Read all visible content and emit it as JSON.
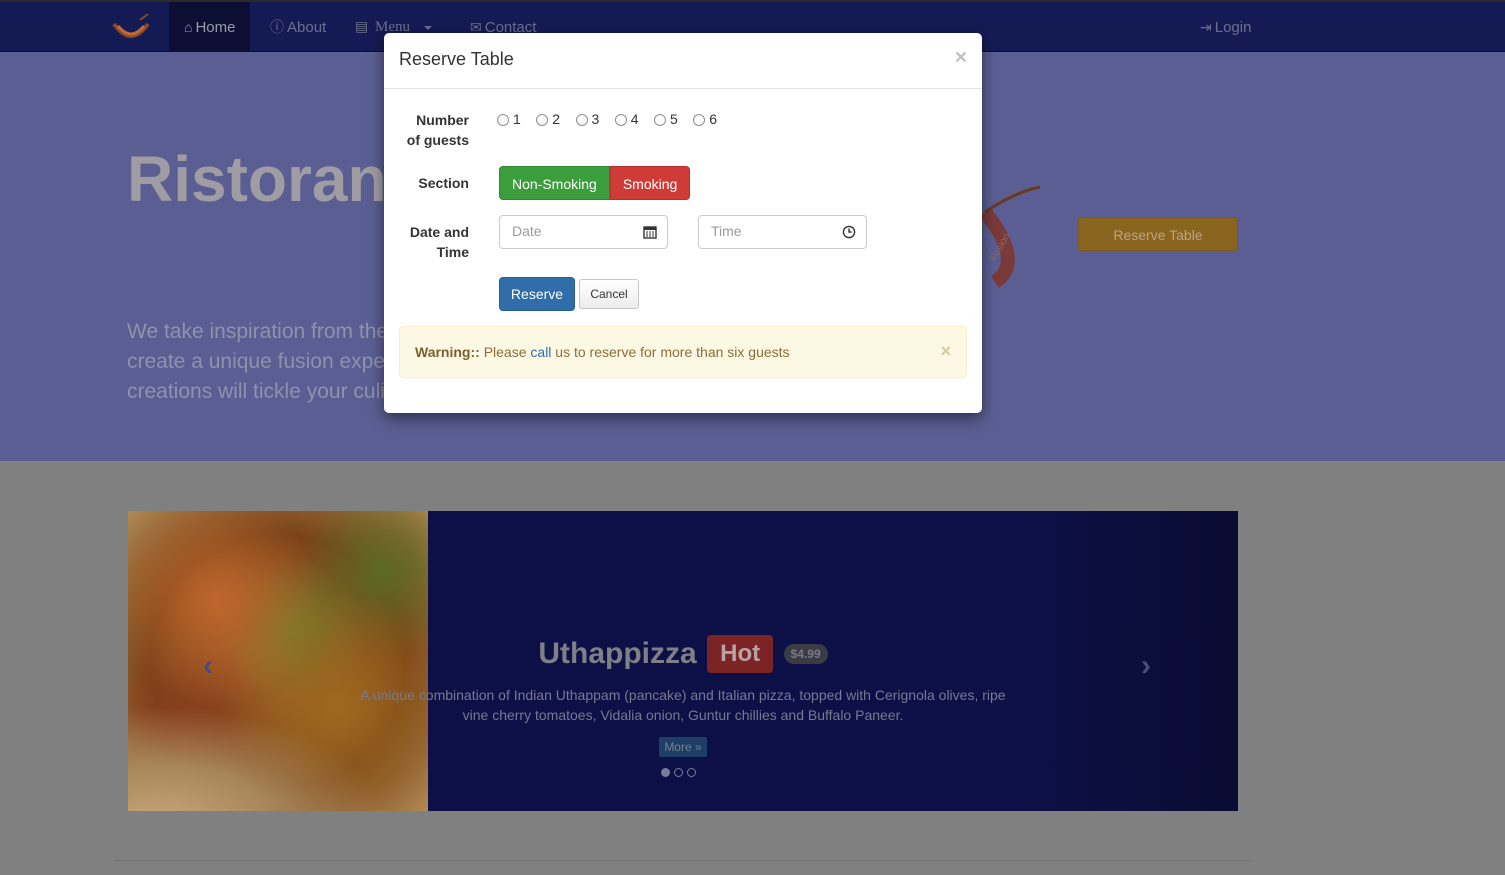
{
  "navbar": {
    "items": [
      {
        "label": "Home",
        "icon": "home-icon",
        "active": true
      },
      {
        "label": "About",
        "icon": "info-icon"
      },
      {
        "label": "Menu",
        "icon": "list-icon"
      },
      {
        "label": "Contact",
        "icon": "envelope-icon"
      }
    ],
    "login": {
      "label": "Login",
      "icon": "login-icon"
    },
    "background": "#141b54"
  },
  "header": {
    "title": "Ristorante",
    "text": "We take inspiration from the World's best cuisines, and create a unique fusion experience. Our lipsmacking creations will tickle your culinary senses!",
    "reserve_button": "Reserve Table",
    "background": "#5a5e92"
  },
  "carousel": {
    "title": "Uthappizza",
    "badge": "Hot",
    "price": "$4.99",
    "description": "A unique combination of Indian Uthappam (pancake) and Italian pizza, topped with Cerignola olives, ripe vine cherry tomatoes, Vidalia onion, Guntur chillies and Buffalo Paneer.",
    "more": "More »",
    "prev": "‹",
    "next": "›",
    "active_slide": 1,
    "slide_count": 3
  },
  "modal": {
    "title": "Reserve Table",
    "close": "×",
    "guests_label_line1": "Number",
    "guests_label_line2": "of guests",
    "guest_options": [
      "1",
      "2",
      "3",
      "4",
      "5",
      "6"
    ],
    "section_label": "Section",
    "sections": {
      "non_smoking": "Non-Smoking",
      "smoking": "Smoking"
    },
    "datetime_label_line1": "Date and",
    "datetime_label_line2": "Time",
    "date_placeholder": "Date",
    "time_placeholder": "Time",
    "reserve_button": "Reserve",
    "cancel_button": "Cancel",
    "alert": {
      "strong": "Warning::",
      "before": " Please ",
      "link": "call",
      "after": " us to reserve for more than six guests",
      "close": "×"
    },
    "colors": {
      "green": "#3b9d3b",
      "red": "#cf3c38",
      "primary": "#2f6ea8",
      "warning_bg": "#fcf8e3"
    }
  }
}
